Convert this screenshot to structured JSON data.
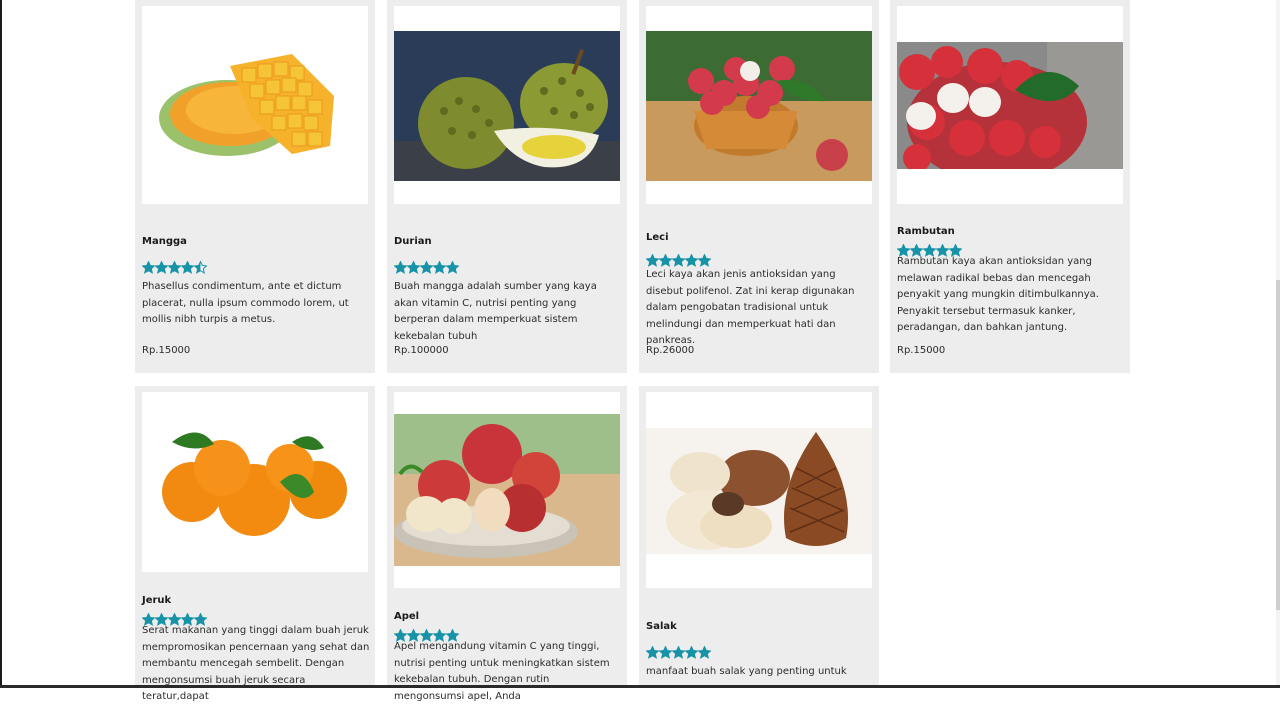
{
  "products": [
    {
      "name": "Mangga",
      "rating": 4.5,
      "description": "Phasellus condimentum, ante et dictum placerat, nulla ipsum commodo lorem, ut mollis nibh turpis a metus.",
      "price": "Rp.15000"
    },
    {
      "name": "Durian",
      "rating": 5,
      "description": "Buah mangga adalah sumber yang kaya akan vitamin C, nutrisi penting yang berperan dalam memperkuat sistem kekebalan tubuh",
      "price": "Rp.100000"
    },
    {
      "name": "Leci",
      "rating": 5,
      "description": "Leci kaya akan jenis antioksidan yang disebut polifenol. Zat ini kerap digunakan dalam pengobatan tradisional untuk melindungi dan memperkuat hati dan pankreas.",
      "price": "Rp.26000"
    },
    {
      "name": "Rambutan",
      "rating": 5,
      "description": "Rambutan kaya akan antioksidan yang melawan radikal bebas dan mencegah penyakit yang mungkin ditimbulkannya. Penyakit tersebut termasuk kanker, peradangan, dan bahkan jantung.",
      "price": "Rp.15000"
    },
    {
      "name": "Jeruk",
      "rating": 5,
      "description": "Serat makanan yang tinggi dalam buah jeruk mempromosikan pencernaan yang sehat dan membantu mencegah sembelit. Dengan mengonsumsi buah jeruk secara teratur,dapat",
      "price": ""
    },
    {
      "name": "Apel",
      "rating": 5,
      "description": "Apel mengandung vitamin C yang tinggi, nutrisi penting untuk meningkatkan sistem kekebalan tubuh. Dengan rutin mengonsumsi apel, Anda",
      "price": ""
    },
    {
      "name": "Salak",
      "rating": 5,
      "description": "manfaat buah salak yang penting untuk",
      "price": ""
    }
  ],
  "colors": {
    "star": "#1793a8",
    "card_bg": "#ededed"
  }
}
